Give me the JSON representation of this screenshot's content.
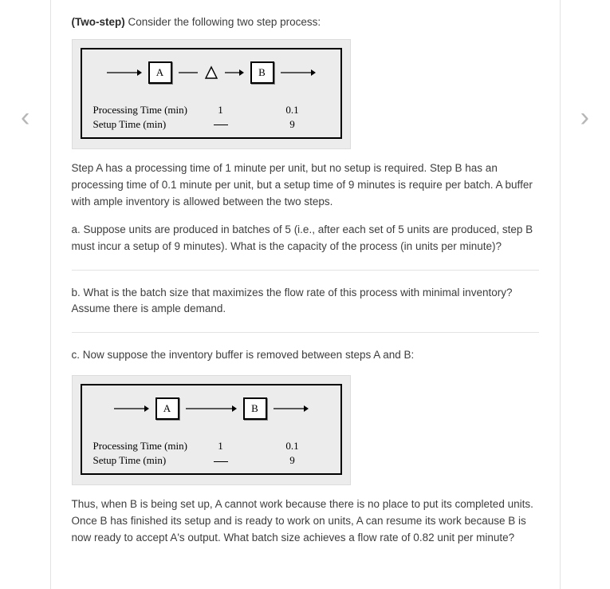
{
  "title_bold": "(Two-step)",
  "title_rest": " Consider the following two step process:",
  "diagram1": {
    "boxA": "A",
    "boxB": "B",
    "has_buffer": true,
    "row1_label": "Processing Time (min)",
    "row1_valA": "1",
    "row1_valB": "0.1",
    "row2_label": "Setup Time (min)",
    "row2_valA_dash": true,
    "row2_valB": "9"
  },
  "para1": "Step A has a processing time of 1 minute per unit, but no setup is required. Step B has an processing time of 0.1 minute per unit, but a setup time of 9 minutes is require per batch. A buffer with ample inventory is allowed between the two steps.",
  "para_a": "a. Suppose units are produced in batches of 5 (i.e., after each set of 5 units are produced, step B must incur a setup of 9 minutes). What is the capacity of the process (in units per minute)?",
  "para_b": "b. What is the batch size that maximizes the flow rate of this process with minimal inventory? Assume there is ample demand.",
  "para_c": "c. Now suppose the inventory buffer is removed between steps A and B:",
  "diagram2": {
    "boxA": "A",
    "boxB": "B",
    "has_buffer": false,
    "row1_label": "Processing Time (min)",
    "row1_valA": "1",
    "row1_valB": "0.1",
    "row2_label": "Setup Time (min)",
    "row2_valA_dash": true,
    "row2_valB": "9"
  },
  "para_c2": "Thus, when B is being set up, A cannot work because there is no place to put its completed units. Once B has finished its setup and is ready to work on units, A can resume its work because B is now ready to accept A's output. What batch size achieves a flow rate of 0.82 unit per minute?"
}
